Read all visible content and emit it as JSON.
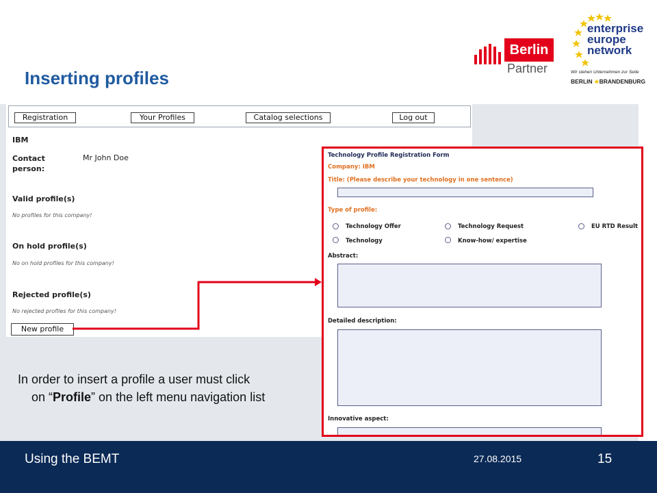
{
  "slide": {
    "title": "Inserting profiles",
    "instruction_line1": "In order to insert a profile a user must click",
    "instruction_line2_pre": "on “",
    "instruction_line2_bold": "Profile",
    "instruction_line2_post": "” on the left menu navigation list"
  },
  "logos": {
    "berlin_partner": {
      "name": "Berlin",
      "sub": "Partner"
    },
    "een": {
      "line1": "enterprise",
      "line2": "europe",
      "line3": "network",
      "tagline": "Wir stehen Unternehmen zur Seite",
      "region_left": "BERLIN",
      "region_right": "BRANDENBURG"
    }
  },
  "app": {
    "nav": [
      {
        "label": "Registration"
      },
      {
        "label": "Your Profiles"
      },
      {
        "label": "Catalog selections"
      },
      {
        "label": "Log out"
      }
    ],
    "company": "IBM",
    "contact_label": "Contact person:",
    "contact_label_1": "Contact",
    "contact_label_2": "person:",
    "contact_value": "Mr John Doe",
    "sections": [
      {
        "heading": "Valid profile(s)",
        "note": "No profiles for this company!"
      },
      {
        "heading": "On hold profile(s)",
        "note": "No on hold profiles for this company!"
      },
      {
        "heading": "Rejected profile(s)",
        "note": "No rejected profiles for this company!"
      }
    ],
    "new_profile_label": "New profile"
  },
  "form": {
    "title": "Technology Profile Registration Form",
    "company": "Company: IBM",
    "title_field_label": "Title: (Please describe your technology in one sentence)",
    "type_label": "Type of profile:",
    "options": [
      "Technology Offer",
      "Technology Request",
      "EU RTD Result",
      "Technology",
      "Know-how/ expertise"
    ],
    "abstract_label": "Abstract:",
    "detailed_label": "Detailed description:",
    "innovative_label": "Innovative aspect:"
  },
  "footer": {
    "left": "Using the BEMT",
    "date": "27.08.2015",
    "page": "15"
  },
  "colors": {
    "title_blue": "#1f5aa0",
    "footer_navy": "#0b2a56",
    "highlight_red": "#e2001a",
    "form_orange": "#e07020"
  }
}
